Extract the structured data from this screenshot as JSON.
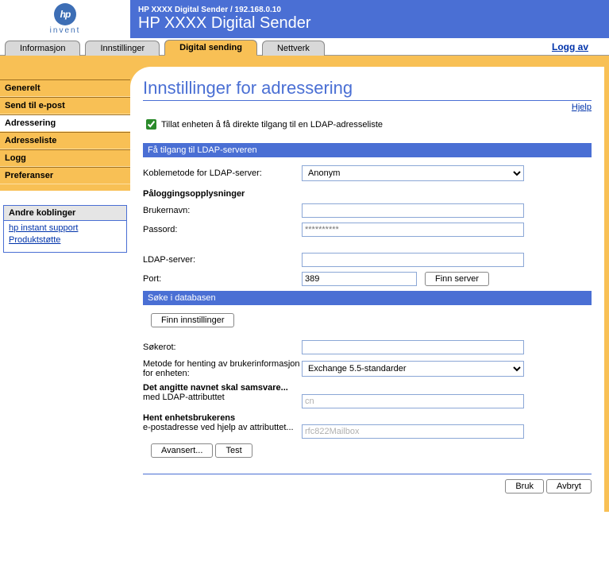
{
  "logo": {
    "text": "hp",
    "sub": "invent"
  },
  "banner": {
    "small": "HP XXXX Digital Sender / 192.168.0.10",
    "large": "HP XXXX Digital Sender"
  },
  "tabs": {
    "info": "Informasjon",
    "settings": "Innstillinger",
    "digital": "Digital sending",
    "network": "Nettverk"
  },
  "logoff": "Logg av",
  "sidebar": {
    "items": {
      "general": "Generelt",
      "sendemail": "Send til e-post",
      "addressing": "Adressering",
      "addresslist": "Adresseliste",
      "log": "Logg",
      "prefs": "Preferanser"
    }
  },
  "other": {
    "heading": "Andre koblinger",
    "link1": "hp instant support",
    "link2": "Produktstøtte"
  },
  "page": {
    "title": "Innstillinger for adressering",
    "help": "Hjelp",
    "allow_label": "Tillat enheten å få direkte tilgang til en LDAP-adresseliste"
  },
  "section1": {
    "bar": "Få tilgang til LDAP-serveren",
    "conn_label": "Koblemetode for LDAP-server:",
    "conn_value": "Anonym",
    "cred_head": "Påloggingsopplysninger",
    "user_label": "Brukernavn:",
    "user_value": "",
    "pass_label": "Passord:",
    "pass_placeholder": "**********",
    "server_label": "LDAP-server:",
    "server_value": "",
    "port_label": "Port:",
    "port_value": "389",
    "find_server_btn": "Finn server"
  },
  "section2": {
    "bar": "Søke i databasen",
    "find_settings_btn": "Finn innstillinger",
    "root_label": "Søkerot:",
    "root_value": "",
    "method_label": "Metode for henting av brukerinformasjon for enheten:",
    "method_value": "Exchange 5.5-standarder",
    "match_head": "Det angitte navnet skal samsvare...",
    "match_label": "med LDAP-attributtet",
    "match_value": "cn",
    "retrieve_head": "Hent enhetsbrukerens",
    "retrieve_label": "e-postadresse ved hjelp av attributtet...",
    "retrieve_value": "rfc822Mailbox",
    "advanced_btn": "Avansert...",
    "test_btn": "Test"
  },
  "footer": {
    "apply": "Bruk",
    "cancel": "Avbryt"
  }
}
